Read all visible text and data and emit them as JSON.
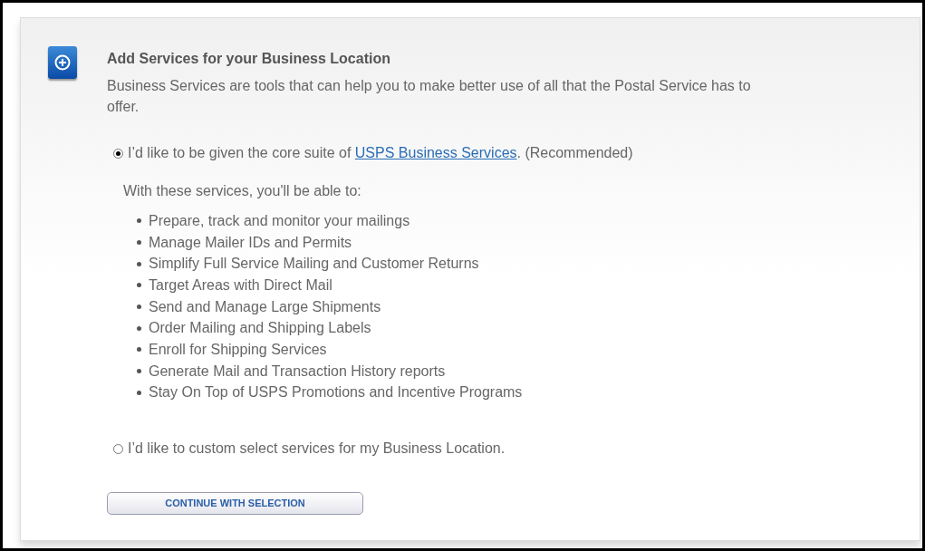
{
  "section": {
    "title": "Add Services for your Business Location",
    "description": "Business Services are tools that can help you to make better use of all that the Postal Service has to offer."
  },
  "options": [
    {
      "selected": true,
      "text_before": "I’d like to be given the core suite of ",
      "link": "USPS Business Services",
      "text_after": ". (Recommended)",
      "intro": "With these services, you'll be able to:",
      "features": [
        "Prepare, track and monitor your mailings",
        "Manage Mailer IDs and Permits",
        "Simplify Full Service Mailing and Customer Returns",
        "Target Areas with Direct Mail",
        "Send and Manage Large Shipments",
        "Order Mailing and Shipping Labels",
        "Enroll for Shipping Services",
        "Generate Mail and Transaction History reports",
        "Stay On Top of USPS Promotions and Incentive Programs"
      ]
    },
    {
      "selected": false,
      "text_before": "I’d like to custom select services for my Business Location."
    }
  ],
  "button": "CONTINUE WITH SELECTION"
}
